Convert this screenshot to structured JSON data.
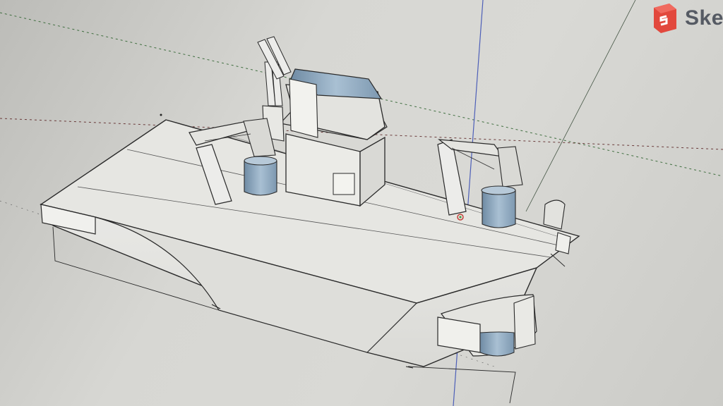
{
  "app": {
    "logo_text": "Ske",
    "logo_icon": "sketchup-logo-icon",
    "brand_color": "#e2483d"
  },
  "model": {
    "description_icons": [
      "axis-green-icon",
      "axis-blue-icon",
      "axis-red-icon"
    ]
  },
  "colors": {
    "background": "#d6d6d2",
    "face_light": "#ededea",
    "face_shade": "#cfcfcc",
    "face_blue": "#8fa9bf",
    "edge": "#2a2a2a",
    "axis_green": "#4a9a4a",
    "axis_blue": "#4d5fb8",
    "axis_red": "#c4413b"
  }
}
